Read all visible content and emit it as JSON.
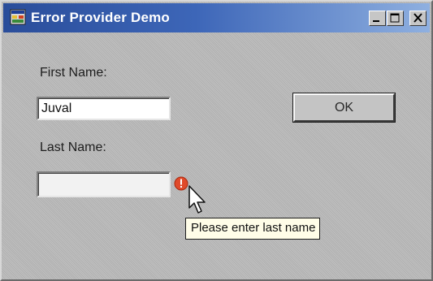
{
  "window": {
    "title": "Error Provider Demo",
    "icon": "app-form-icon",
    "controls": {
      "minimize_icon": "minimize-icon",
      "maximize_icon": "maximize-icon",
      "close_icon": "close-icon"
    },
    "titlebar_colors": [
      "#2a4d9a",
      "#8fb0e0"
    ]
  },
  "form": {
    "first_name_label": "First Name:",
    "first_name_value": "Juval",
    "last_name_label": "Last Name:",
    "last_name_value": "",
    "ok_label": "OK"
  },
  "error": {
    "icon": "error-icon",
    "icon_color": "#e04a2a",
    "tooltip": "Please enter last name"
  },
  "cursor": {
    "icon": "mouse-pointer-icon"
  }
}
